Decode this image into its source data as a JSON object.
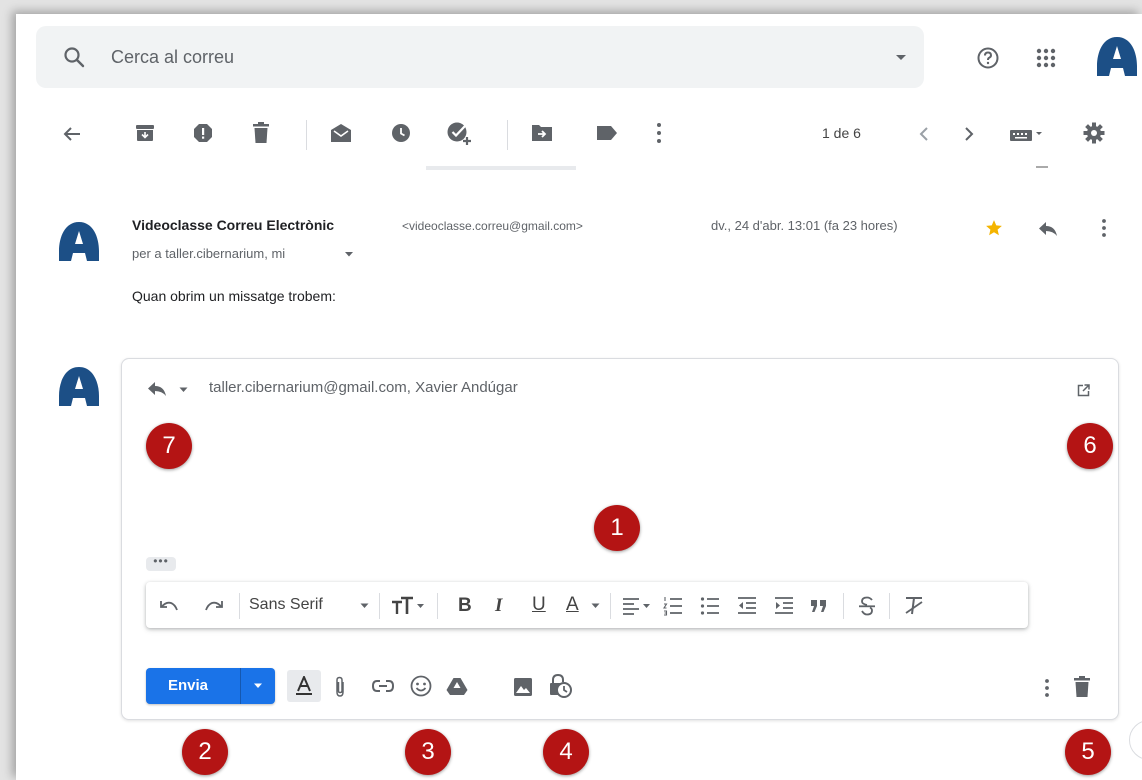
{
  "search": {
    "placeholder": "Cerca al correu"
  },
  "toolbar": {
    "pager": "1 de 6"
  },
  "message": {
    "sender_name": "Videoclasse Correu Electrònic",
    "sender_email": "<videoclasse.correu@gmail.com>",
    "date": "dv., 24 d'abr. 13:01 (fa 23 hores)",
    "to_line": "per a taller.cibernarium, mi",
    "body": "Quan obrim un missatge trobem:",
    "starred": true
  },
  "reply": {
    "recipients": "taller.cibernarium@gmail.com, Xavier Andúgar",
    "more_dots": "•••",
    "font": "Sans Serif",
    "send_label": "Envia"
  },
  "badges": [
    "1",
    "2",
    "3",
    "4",
    "5",
    "6",
    "7"
  ],
  "colors": {
    "send_blue": "#1a73e8",
    "badge_red": "#b41414",
    "avatar_blue": "#1c4f86",
    "star_yellow": "#f4b400"
  }
}
